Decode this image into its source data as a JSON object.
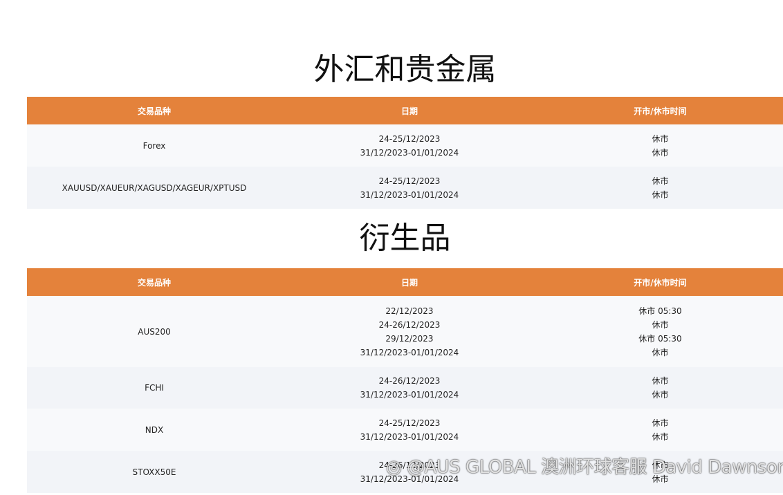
{
  "sections": [
    {
      "title": "外汇和贵金属",
      "headers": [
        "交易品种",
        "日期",
        "开市/休市时间"
      ],
      "rows": [
        {
          "symbol": "Forex",
          "dates": [
            "24-25/12/2023",
            "31/12/2023-01/01/2024"
          ],
          "times": [
            "休市",
            "休市"
          ]
        },
        {
          "symbol": "XAUUSD/XAUEUR/XAGUSD/XAGEUR/XPTUSD",
          "dates": [
            "24-25/12/2023",
            "31/12/2023-01/01/2024"
          ],
          "times": [
            "休市",
            "休市"
          ]
        }
      ]
    },
    {
      "title": "衍生品",
      "headers": [
        "交易品种",
        "日期",
        "开市/休市时间"
      ],
      "rows": [
        {
          "symbol": "AUS200",
          "dates": [
            "22/12/2023",
            "24-26/12/2023",
            "29/12/2023",
            "31/12/2023-01/01/2024"
          ],
          "times": [
            "休市 05:30",
            "休市",
            "休市 05:30",
            "休市"
          ]
        },
        {
          "symbol": "FCHI",
          "dates": [
            "24-26/12/2023",
            "31/12/2023-01/01/2024"
          ],
          "times": [
            "休市",
            "休市"
          ]
        },
        {
          "symbol": "NDX",
          "dates": [
            "24-25/12/2023",
            "31/12/2023-01/01/2024"
          ],
          "times": [
            "休市",
            "休市"
          ]
        },
        {
          "symbol": "STOXX50E",
          "dates": [
            "24-26/12/2023",
            "31/12/2023-01/01/2024"
          ],
          "times": [
            "休市",
            "休市"
          ]
        }
      ]
    }
  ],
  "watermark": "@AUS GLOBAL 澳洲环球客服 David Dawnson",
  "colors": {
    "header_bg": "#e4823b",
    "row_odd": "#f8f9fb",
    "row_even": "#f2f4f8"
  }
}
